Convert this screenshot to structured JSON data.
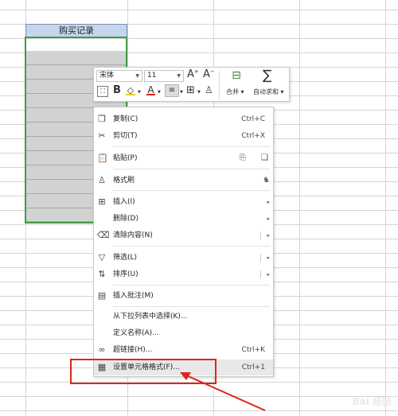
{
  "sheet": {
    "column_header": "购买记录"
  },
  "toolbar": {
    "font_name": "宋体",
    "font_size": "11",
    "increase_font": "A",
    "decrease_font": "A",
    "bold": "B",
    "font_color_glyph": "A",
    "merge_label": "合并",
    "autosum_label": "自动求和"
  },
  "menu": {
    "items": [
      {
        "label": "复制(C)",
        "shortcut": "Ctrl+C",
        "icon": "copy-icon"
      },
      {
        "label": "剪切(T)",
        "shortcut": "Ctrl+X",
        "icon": "cut-icon"
      },
      {
        "label": "粘贴(P)",
        "shortcut": "",
        "icon": "paste-icon"
      },
      {
        "label": "格式刷",
        "shortcut": "",
        "icon": "format-painter-icon"
      },
      {
        "label": "插入(I)",
        "shortcut": "",
        "icon": "insert-icon"
      },
      {
        "label": "删除(D)",
        "shortcut": "",
        "icon": ""
      },
      {
        "label": "清除内容(N)",
        "shortcut": "",
        "icon": "clear-icon"
      },
      {
        "label": "筛选(L)",
        "shortcut": "",
        "icon": "filter-icon"
      },
      {
        "label": "排序(U)",
        "shortcut": "",
        "icon": "sort-icon"
      },
      {
        "label": "插入批注(M)",
        "shortcut": "",
        "icon": "comment-icon"
      },
      {
        "label": "从下拉列表中选择(K)...",
        "shortcut": "",
        "icon": ""
      },
      {
        "label": "定义名称(A)...",
        "shortcut": "",
        "icon": ""
      },
      {
        "label": "超链接(H)...",
        "shortcut": "Ctrl+K",
        "icon": "link-icon"
      },
      {
        "label": "设置单元格格式(F)...",
        "shortcut": "Ctrl+1",
        "icon": "format-cells-icon"
      }
    ]
  },
  "watermark": "Bai 经验"
}
